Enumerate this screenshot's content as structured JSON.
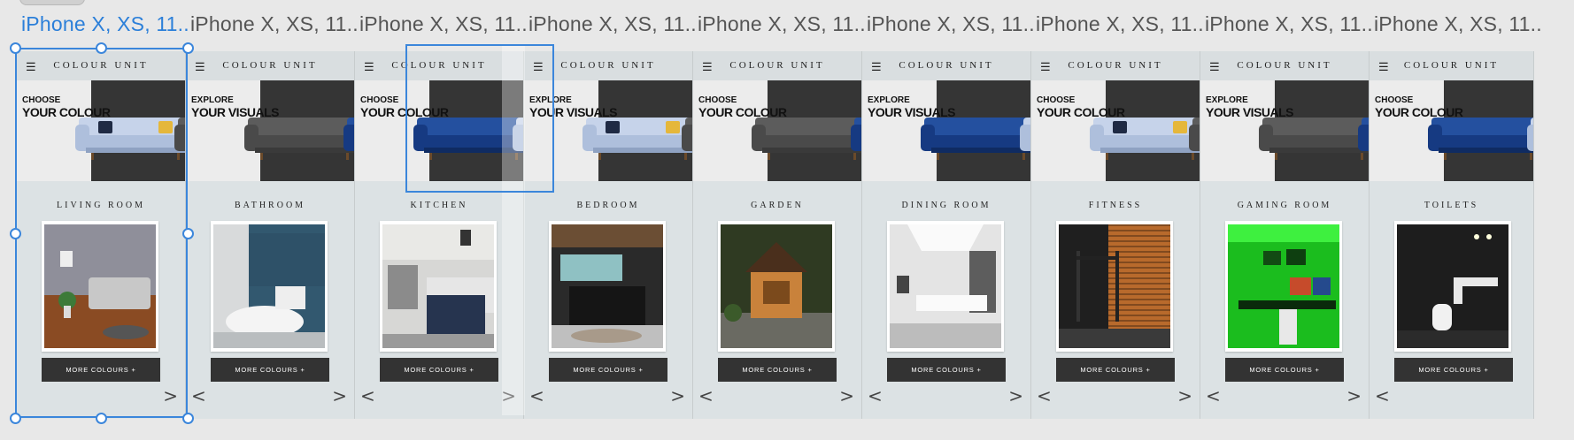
{
  "artboard_label": "iPhone X, XS, 11...",
  "brand": "COLOUR UNIT",
  "more_label": "MORE COLOURS +",
  "hero_variants": {
    "choose": {
      "line1": "CHOOSE",
      "line2": "YOUR COLOUR"
    },
    "explore": {
      "line1": "EXPLORE",
      "line2": "YOUR VISUALS"
    }
  },
  "colors": {
    "selection": "#3b86db",
    "button": "#333333",
    "hero_dark": "#353535",
    "section_bg": "#dce2e4"
  },
  "boards": [
    {
      "room": "LIVING ROOM",
      "hero": "choose",
      "photo": "living-room-photo"
    },
    {
      "room": "BATHROOM",
      "hero": "explore",
      "photo": "bathroom-photo"
    },
    {
      "room": "KITCHEN",
      "hero": "choose",
      "photo": "kitchen-photo"
    },
    {
      "room": "BEDROOM",
      "hero": "explore",
      "photo": "bedroom-photo"
    },
    {
      "room": "GARDEN",
      "hero": "choose",
      "photo": "garden-photo"
    },
    {
      "room": "DINING ROOM",
      "hero": "explore",
      "photo": "dining-room-photo"
    },
    {
      "room": "FITNESS",
      "hero": "choose",
      "photo": "fitness-photo"
    },
    {
      "room": "GAMING ROOM",
      "hero": "explore",
      "photo": "gaming-room-photo"
    },
    {
      "room": "TOILETS",
      "hero": "choose",
      "photo": "toilets-photo"
    }
  ]
}
